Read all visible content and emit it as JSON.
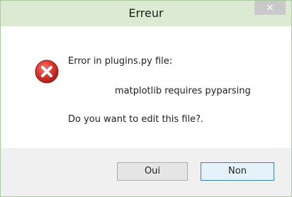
{
  "dialog": {
    "title": "Erreur",
    "close_label": "×",
    "icon": "error-icon",
    "message_line1": "Error in plugins.py file:",
    "message_line2": "matplotlib requires pyparsing",
    "question": "Do you want to edit this file?.",
    "buttons": {
      "yes_label": "Oui",
      "no_label": "Non"
    }
  },
  "colors": {
    "titlebar": "#dce9d3",
    "window_border": "#a9c9a0",
    "error_red": "#d9342b",
    "footer": "#f0f0f0",
    "default_button_border": "#3c7fb1"
  }
}
